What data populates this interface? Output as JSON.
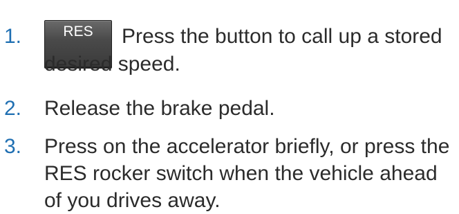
{
  "steps": [
    {
      "number": "1.",
      "button_label": "RES",
      "text_line_1": "Press the button to call up a stored",
      "text_line_2": "desired speed."
    },
    {
      "number": "2.",
      "text": "Release the brake pedal."
    },
    {
      "number": "3.",
      "text": "Press on the accelerator briefly, or press the RES rocker switch when the vehicle ahead of you drives away."
    }
  ],
  "colors": {
    "number": "#1f6fb2",
    "text": "#2b2b2b",
    "button": "#4a4a4a",
    "button_label": "#ffffff"
  }
}
